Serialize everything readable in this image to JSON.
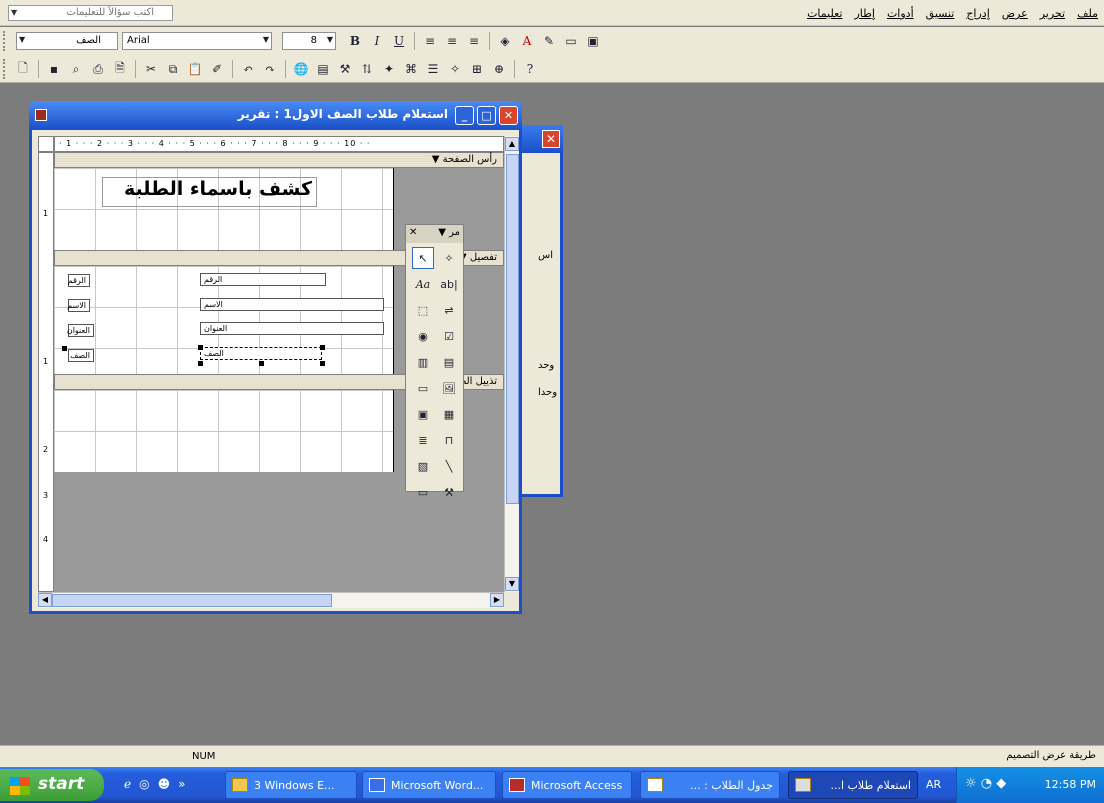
{
  "menubar": {
    "help_placeholder": "اكتب سؤالاً للتعليمات",
    "items": [
      "ملف",
      "تحرير",
      "عرض",
      "إدراج",
      "تنسيق",
      "أدوات",
      "إطار",
      "تعليمات"
    ]
  },
  "format_toolbar": {
    "object_combo": "الصف",
    "font_combo": "Arial",
    "size_combo": "8",
    "bold": "B",
    "italic": "I",
    "underline": "U"
  },
  "report_window": {
    "title": "استعلام طلاب الصف الاول1 : تقرير",
    "ruler_text": "· 1 · · · 2 · · · 3 · · · 4 · · · 5 · · · 6 · · · 7 · · · 8 · · · 9 · · · 10 · ·",
    "vruler": [
      "1",
      "2",
      "3",
      "4"
    ],
    "sections": {
      "page_header": "رأس الصفحة",
      "detail": "تفصيل",
      "page_footer": "تذييل الصفحة"
    },
    "header_title": "كشف باسماء الطلبة",
    "labels": [
      "الرقم",
      "الاسم",
      "العنوان",
      "الصف"
    ],
    "fields": [
      "الرقم",
      "الاسم",
      "العنوان",
      "الصف"
    ]
  },
  "back_window": {
    "texts": [
      "اس",
      "وحد",
      "وحدا"
    ]
  },
  "toolbox": {
    "title": "مر",
    "tools": [
      "select-icon",
      "wizard-icon",
      "label-icon",
      "textbox-icon",
      "option-group-icon",
      "toggle-icon",
      "option-icon",
      "checkbox-icon",
      "combobox-icon",
      "listbox-icon",
      "command-button-icon",
      "image-icon",
      "unbound-frame-icon",
      "bound-frame-icon",
      "page-break-icon",
      "tab-control-icon",
      "subform-icon",
      "line-icon",
      "rectangle-icon",
      "more-controls-icon"
    ]
  },
  "statusbar": {
    "num": "NUM",
    "mode": "طريقة عرض التصميم"
  },
  "taskbar": {
    "start": "start",
    "buttons": [
      "3 Windows E...",
      "Microsoft Word...",
      "Microsoft Access",
      "جدول الطلاب : ...",
      "استعلام طلاب ا..."
    ],
    "lang": "AR",
    "clock": "12:58 PM"
  }
}
